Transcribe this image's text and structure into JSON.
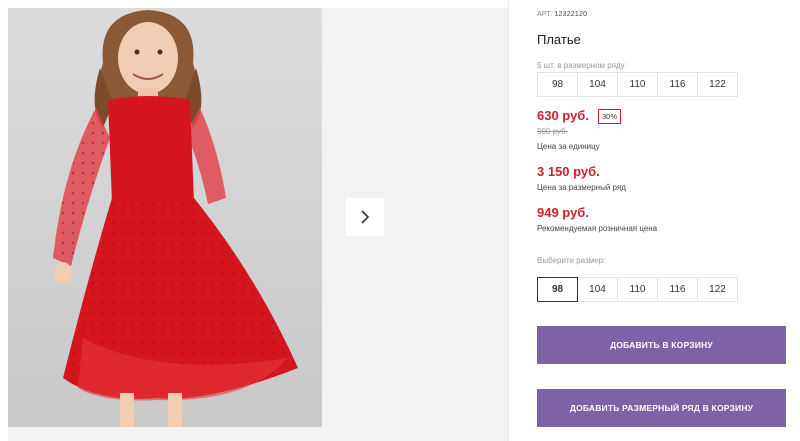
{
  "product": {
    "article_label": "АРТ.",
    "article": "12322120",
    "title": "Платье"
  },
  "series": {
    "hint": "5 шт. в размерном ряду",
    "sizes": [
      "98",
      "104",
      "110",
      "116",
      "122"
    ]
  },
  "prices": {
    "unit_price": "630 руб.",
    "discount": "30%",
    "old_price": "900 руб.",
    "unit_caption": "Цена за единицу",
    "set_price": "3 150 руб.",
    "set_caption": "Цена за размерный ряд",
    "retail_price": "949 руб.",
    "retail_caption": "Рекомендуемая розничная цена"
  },
  "size_picker": {
    "hint": "Выберите размер:",
    "sizes": [
      "98",
      "104",
      "110",
      "116",
      "122"
    ],
    "selected": "98"
  },
  "buttons": {
    "add_to_cart": "ДОБАВИТЬ В КОРЗИНУ",
    "add_series": "ДОБАВИТЬ РАЗМЕРНЫЙ РЯД В КОРЗИНУ"
  },
  "colors": {
    "accent_red": "#d0202b",
    "button_purple": "#7e62a6",
    "dress_red": "#d5161f"
  },
  "icons": {
    "next": "chevron-right-icon"
  }
}
